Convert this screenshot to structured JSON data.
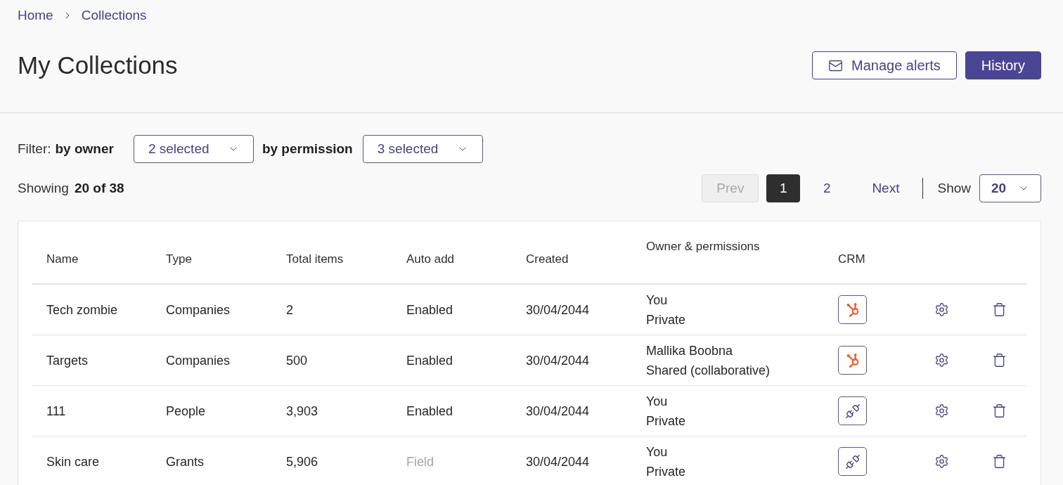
{
  "breadcrumb": [
    {
      "label": "Home"
    },
    {
      "label": "Collections"
    }
  ],
  "page_title": "My Collections",
  "header_buttons": [
    {
      "label": "Manage alerts",
      "kind": "outline"
    },
    {
      "label": "History",
      "kind": "primary"
    }
  ],
  "filters": {
    "label": "Filter:",
    "groups": [
      {
        "label": "by owner",
        "value": "2 selected"
      },
      {
        "label": "by permission",
        "value": "3 selected"
      }
    ]
  },
  "summary": {
    "label": "Showing",
    "count": "20 of 38"
  },
  "pagination": {
    "prev": {
      "label": "Prev",
      "disabled": true
    },
    "pages": [
      {
        "label": "1",
        "selected": true
      },
      {
        "label": "2",
        "selected": false
      }
    ],
    "next": {
      "label": "Next",
      "disabled": false
    },
    "page_size_label": "Show",
    "page_size": "20"
  },
  "table": {
    "columns": [
      "Name",
      "Type",
      "Total items",
      "Auto add",
      "Created",
      "Owner & permissions",
      "CRM"
    ],
    "rows": [
      {
        "name": "Tech zombie",
        "type": "Companies",
        "total_items": "2",
        "auto_add": "Enabled",
        "auto_add_disabled": false,
        "created": "30/04/2044",
        "owner": "You",
        "permission": "Private",
        "crm": {
          "kind": "hubspot"
        }
      },
      {
        "name": "Targets",
        "type": "Companies",
        "total_items": "500",
        "auto_add": "Enabled",
        "auto_add_disabled": false,
        "created": "30/04/2044",
        "owner": "Mallika Boobna",
        "permission": "Shared (collaborative)",
        "crm": {
          "kind": "hubspot"
        }
      },
      {
        "name": "111",
        "type": "People",
        "total_items": "3,903",
        "auto_add": "Enabled",
        "auto_add_disabled": false,
        "created": "30/04/2044",
        "owner": "You",
        "permission": "Private",
        "crm": {
          "kind": "plug"
        }
      },
      {
        "name": "Skin care",
        "type": "Grants",
        "total_items": "5,906",
        "auto_add": "Field",
        "auto_add_disabled": true,
        "created": "30/04/2044",
        "owner": "You",
        "permission": "Private",
        "crm": {
          "kind": "plug"
        }
      }
    ]
  }
}
